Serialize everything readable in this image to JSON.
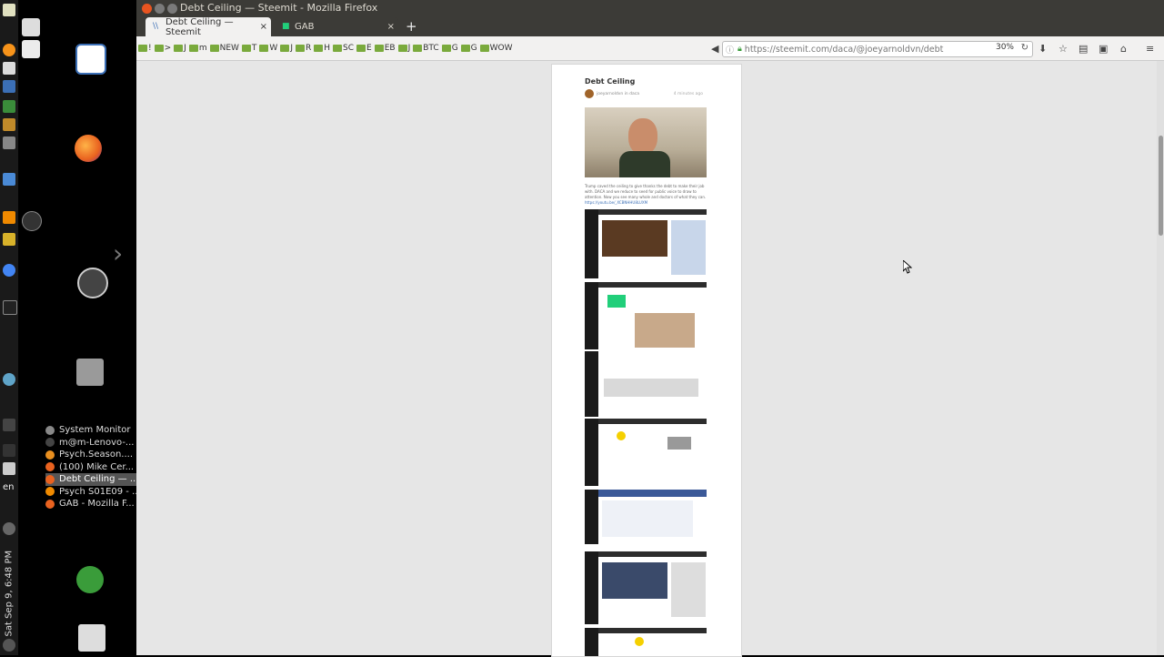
{
  "window": {
    "title": "Debt Ceiling — Steemit - Mozilla Firefox"
  },
  "tabs": [
    {
      "label": "Debt Ceiling — Steemit",
      "close": "×"
    },
    {
      "label": "GAB",
      "close": "×"
    }
  ],
  "newtab": "+",
  "bookmarks": [
    "!",
    ">",
    "J",
    "m",
    "NEW",
    "T",
    "W",
    "J",
    "R",
    "H",
    "SC",
    "E",
    "EB",
    "J",
    "BTC",
    "G",
    "G",
    "WOW"
  ],
  "url": {
    "value": "https://steemit.com/daca/@joeyarnoldvn/debt",
    "zoom": "30%"
  },
  "taskbar": {
    "clock": "Sat Sep 9, 6:48 PM",
    "lang": "en",
    "windows": [
      {
        "label": "System Monitor",
        "color": "#888888"
      },
      {
        "label": "m@m-Lenovo-...",
        "color": "#444444"
      },
      {
        "label": "Psych.Season....",
        "color": "#e98f1f"
      },
      {
        "label": "(100) Mike Cer...",
        "color": "#e9621f"
      },
      {
        "label": "Debt Ceiling — ...",
        "color": "#e9621f",
        "active": true
      },
      {
        "label": "Psych S01E09 - ...",
        "color": "#f08a00"
      },
      {
        "label": "GAB - Mozilla F...",
        "color": "#e9621f"
      }
    ]
  },
  "article": {
    "title": "Debt Ceiling",
    "author": "joeyarnoldvn",
    "category": "in daca",
    "timestamp": "4 minutes ago",
    "text": "Trump caved the ceiling to give thanks the debt to make their job with. DACA and we reduce to seed for public voice to draw to attention. Now you see many whole and doctors of what they can.",
    "link": "https://youtu.be/_XCBNHHU8LUXM"
  },
  "icons": {
    "back": "back-arrow-icon",
    "reload": "reload-icon",
    "download": "download-icon",
    "star": "bookmark-star-icon",
    "home": "home-icon",
    "menu": "hamburger-menu-icon"
  }
}
